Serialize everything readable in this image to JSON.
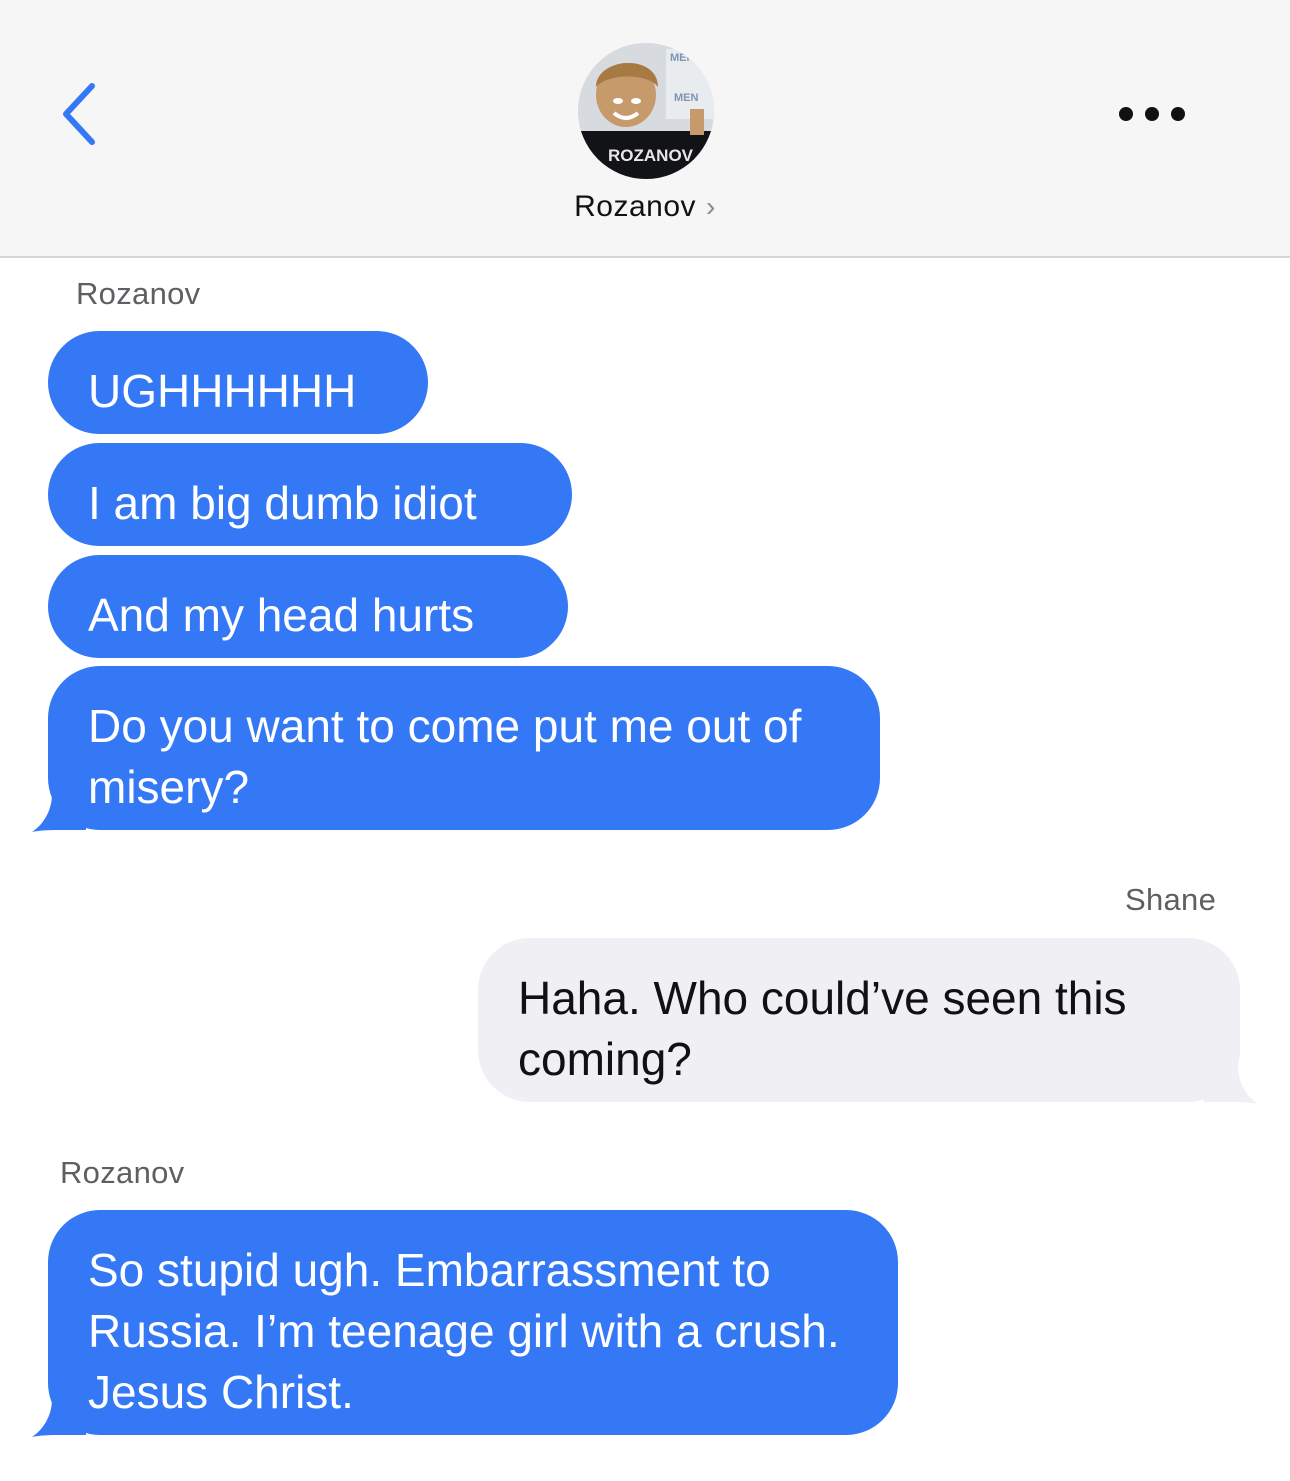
{
  "header": {
    "contact_name": "Rozanov",
    "contact_chevron": "›",
    "back_icon": "chevron-left-icon",
    "more_icon": "ellipsis-icon",
    "avatar_jersey_text": "ROZANOV",
    "avatar_backdrop_text": "MEN"
  },
  "colors": {
    "incoming_bubble": "#3478f6",
    "outgoing_bubble": "#efeff4",
    "accent": "#3478f6",
    "header_bg": "#f6f6f6"
  },
  "conversation": {
    "group1": {
      "sender": "Rozanov",
      "messages": [
        "UGHHHHHH",
        "I am big dumb idiot",
        "And my head hurts",
        "Do you want to come put me out of misery?"
      ]
    },
    "group2": {
      "sender": "Shane",
      "messages": [
        "Haha. Who could’ve seen this coming?"
      ]
    },
    "group3": {
      "sender": "Rozanov",
      "messages": [
        "So stupid ugh. Embarrassment to Russia. I’m teenage girl with a crush. Jesus Christ."
      ]
    }
  }
}
